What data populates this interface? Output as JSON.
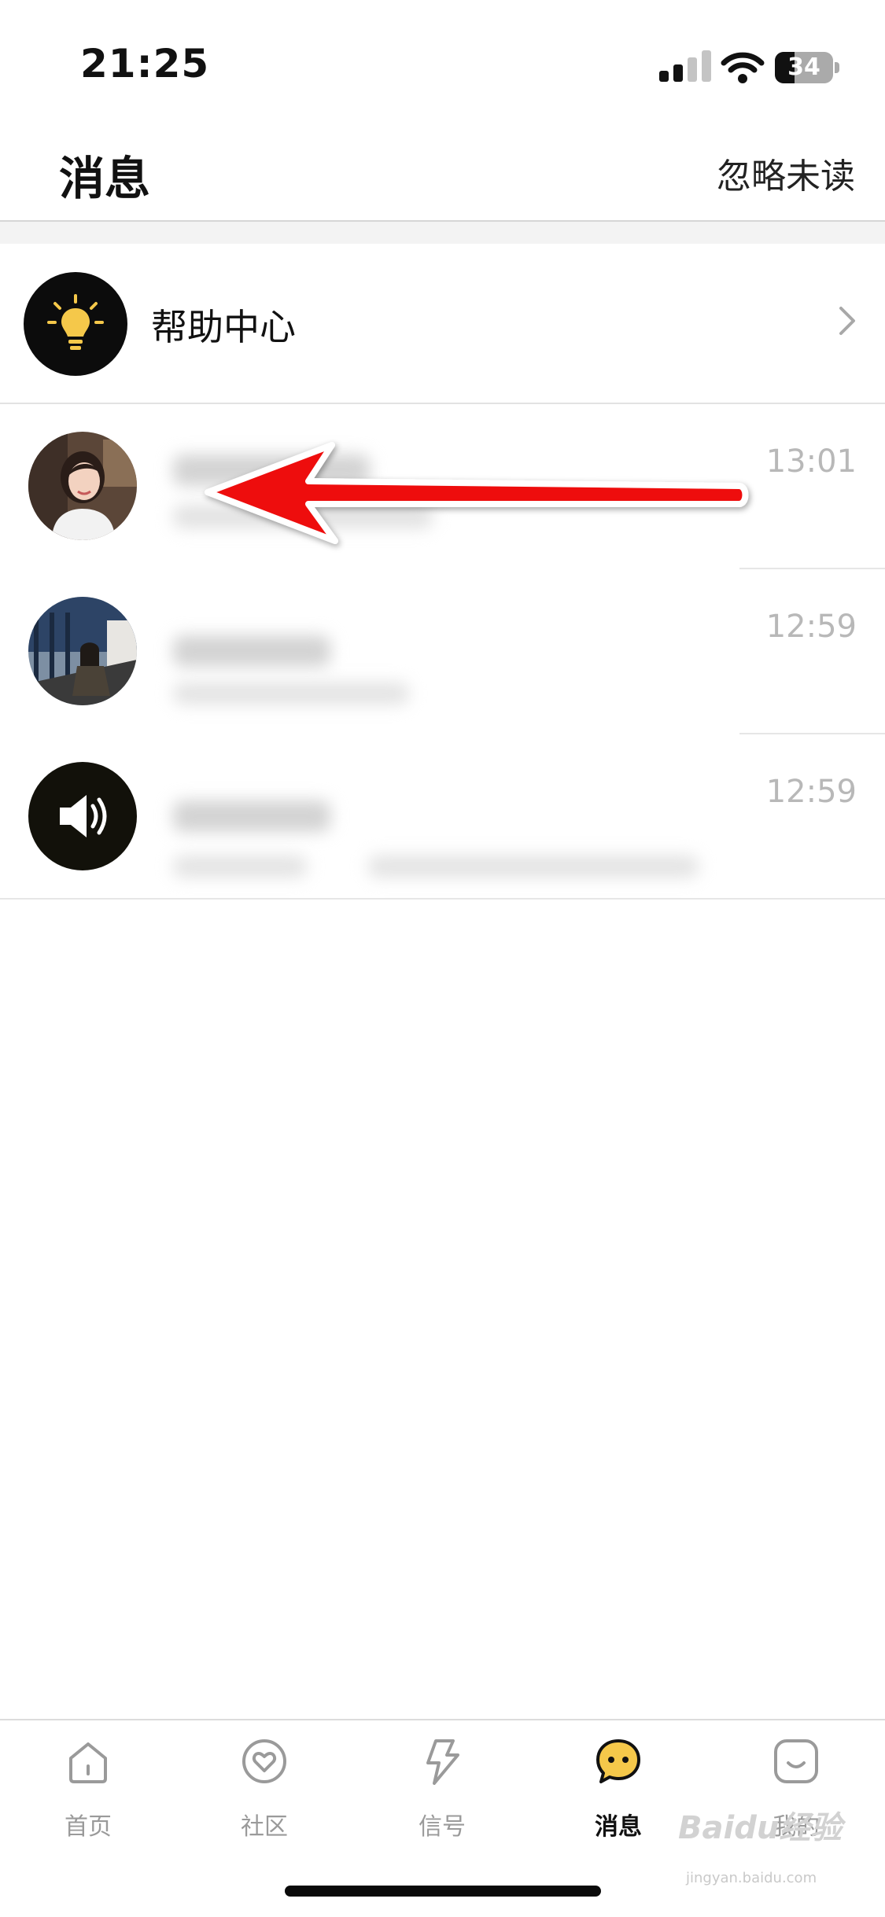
{
  "status_bar": {
    "time": "21:25",
    "battery_percent": "34",
    "battery_level": 0.34,
    "signal_bars_active": 2,
    "signal_bars_total": 4
  },
  "header": {
    "title": "消息",
    "ignore_unread": "忽略未读"
  },
  "help_center": {
    "label": "帮助中心",
    "icon": "lightbulb-icon"
  },
  "messages": [
    {
      "time": "13:01",
      "avatar": "user-photo-1"
    },
    {
      "time": "12:59",
      "avatar": "user-photo-2"
    },
    {
      "time": "12:59",
      "avatar": "speaker-icon"
    }
  ],
  "tabbar": {
    "items": [
      {
        "label": "首页",
        "icon": "home-icon"
      },
      {
        "label": "社区",
        "icon": "heart-circle-icon"
      },
      {
        "label": "信号",
        "icon": "lightning-icon"
      },
      {
        "label": "消息",
        "icon": "chat-bubble-icon",
        "active": true
      },
      {
        "label": "我的",
        "icon": "smile-face-icon"
      }
    ]
  },
  "watermark": {
    "logo_text": "Baidu经验",
    "url": "jingyan.baidu.com"
  },
  "colors": {
    "accent_yellow": "#f5c84a",
    "annotation_red": "#ee1111",
    "time_gray": "#b8b8b8"
  }
}
